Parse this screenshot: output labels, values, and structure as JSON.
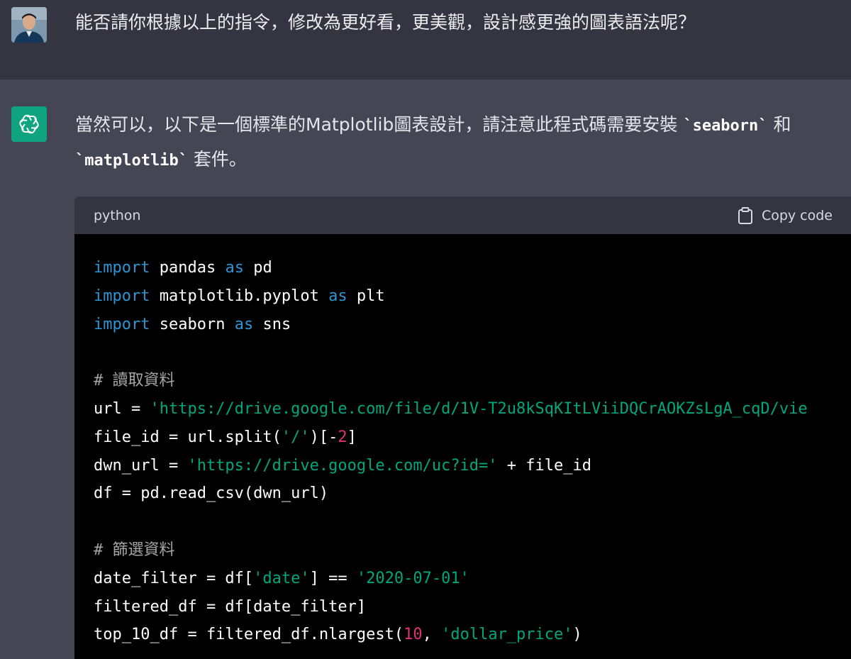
{
  "user_message": {
    "text": "能否請你根據以上的指令，修改為更好看，更美觀，設計感更強的圖表語法呢？"
  },
  "assistant_message": {
    "intro_part1": "當然可以，以下是一個標準的Matplotlib圖表設計，請注意此程式碼需要安裝 ",
    "inline_code_1": "`seaborn`",
    "intro_part2": " 和",
    "inline_code_2": "`matplotlib`",
    "intro_part3": " 套件。"
  },
  "code_block": {
    "language": "python",
    "copy_label": "Copy code",
    "lines": {
      "l1": {
        "kw1": "import",
        "t1": " pandas ",
        "kw2": "as",
        "t2": " pd"
      },
      "l2": {
        "kw1": "import",
        "t1": " matplotlib.pyplot ",
        "kw2": "as",
        "t2": " plt"
      },
      "l3": {
        "kw1": "import",
        "t1": " seaborn ",
        "kw2": "as",
        "t2": " sns"
      },
      "l5": {
        "comment": "# 讀取資料"
      },
      "l6": {
        "t1": "url = ",
        "s1": "'https://drive.google.com/file/d/1V-T2u8kSqKItLViiDQCrAOKZsLgA_cqD/vie"
      },
      "l7": {
        "t1": "file_id = url.split(",
        "s1": "'/'",
        "t2": ")[-",
        "n1": "2",
        "t3": "]"
      },
      "l8": {
        "t1": "dwn_url = ",
        "s1": "'https://drive.google.com/uc?id='",
        "t2": " + file_id"
      },
      "l9": {
        "t1": "df = pd.read_csv(dwn_url)"
      },
      "l11": {
        "comment": "# 篩選資料"
      },
      "l12": {
        "t1": "date_filter = df[",
        "s1": "'date'",
        "t2": "] == ",
        "s2": "'2020-07-01'"
      },
      "l13": {
        "t1": "filtered_df = df[date_filter]"
      },
      "l14": {
        "t1": "top_10_df = filtered_df.nlargest(",
        "n1": "10",
        "t2": ", ",
        "s1": "'dollar_price'",
        "t3": ")"
      }
    }
  }
}
